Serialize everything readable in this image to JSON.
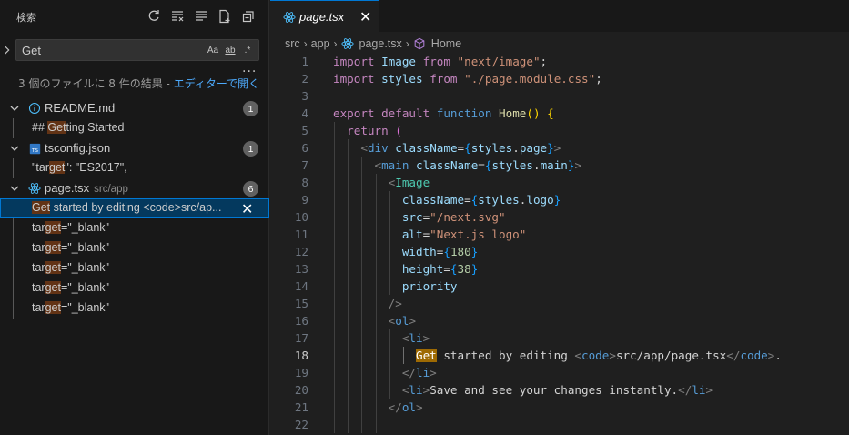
{
  "sidebar": {
    "title": "検索",
    "search": {
      "value": "Get",
      "options": [
        "Aa",
        "ab",
        ".*"
      ]
    },
    "more": "...",
    "summary": {
      "text": "3 個のファイルに 8 件の結果 - ",
      "link": "エディターで開く"
    },
    "results": [
      {
        "kind": "file",
        "name": "README.md",
        "path": "",
        "count": "1",
        "icon": "info-icon",
        "matches": [
          {
            "pre": "## ",
            "hit": "Get",
            "post": "ting Started"
          }
        ]
      },
      {
        "kind": "file",
        "name": "tsconfig.json",
        "path": "",
        "count": "1",
        "icon": "ts-config-icon",
        "matches": [
          {
            "pre": "\"tar",
            "hit": "get",
            "post": "\": \"ES2017\","
          }
        ]
      },
      {
        "kind": "file",
        "name": "page.tsx",
        "path": "src/app",
        "count": "6",
        "icon": "react-icon",
        "matches": [
          {
            "pre": "",
            "hit": "Get",
            "post": " started by editing <code>src/ap...",
            "selected": true
          },
          {
            "pre": "tar",
            "hit": "get",
            "post": "=\"_blank\""
          },
          {
            "pre": "tar",
            "hit": "get",
            "post": "=\"_blank\""
          },
          {
            "pre": "tar",
            "hit": "get",
            "post": "=\"_blank\""
          },
          {
            "pre": "tar",
            "hit": "get",
            "post": "=\"_blank\""
          },
          {
            "pre": "tar",
            "hit": "get",
            "post": "=\"_blank\""
          }
        ]
      }
    ]
  },
  "editor": {
    "tab": {
      "label": "page.tsx"
    },
    "breadcrumb": [
      "src",
      "app",
      "page.tsx",
      "Home"
    ],
    "active_line": 18,
    "lines": [
      [
        [
          "k",
          "import"
        ],
        [
          "w",
          " "
        ],
        [
          "v",
          "Image"
        ],
        [
          "w",
          " "
        ],
        [
          "k",
          "from"
        ],
        [
          "w",
          " "
        ],
        [
          "s",
          "\"next/image\""
        ],
        [
          "w",
          ";"
        ]
      ],
      [
        [
          "k",
          "import"
        ],
        [
          "w",
          " "
        ],
        [
          "v",
          "styles"
        ],
        [
          "w",
          " "
        ],
        [
          "k",
          "from"
        ],
        [
          "w",
          " "
        ],
        [
          "s",
          "\"./page.module.css\""
        ],
        [
          "w",
          ";"
        ]
      ],
      [],
      [
        [
          "k",
          "export"
        ],
        [
          "w",
          " "
        ],
        [
          "k",
          "default"
        ],
        [
          "w",
          " "
        ],
        [
          "kb",
          "function"
        ],
        [
          "w",
          " "
        ],
        [
          "f",
          "Home"
        ],
        [
          "br1",
          "()"
        ],
        [
          "w",
          " "
        ],
        [
          "br1",
          "{"
        ]
      ],
      [
        [
          "w",
          "  "
        ],
        [
          "k",
          "return"
        ],
        [
          "w",
          " "
        ],
        [
          "br2",
          "("
        ]
      ],
      [
        [
          "w",
          "    "
        ],
        [
          "p",
          "<"
        ],
        [
          "kb",
          "div"
        ],
        [
          "w",
          " "
        ],
        [
          "v",
          "className"
        ],
        [
          "w",
          "="
        ],
        [
          "br3",
          "{"
        ],
        [
          "v",
          "styles"
        ],
        [
          "w",
          "."
        ],
        [
          "v",
          "page"
        ],
        [
          "br3",
          "}"
        ],
        [
          "p",
          ">"
        ]
      ],
      [
        [
          "w",
          "      "
        ],
        [
          "p",
          "<"
        ],
        [
          "kb",
          "main"
        ],
        [
          "w",
          " "
        ],
        [
          "v",
          "className"
        ],
        [
          "w",
          "="
        ],
        [
          "br3",
          "{"
        ],
        [
          "v",
          "styles"
        ],
        [
          "w",
          "."
        ],
        [
          "v",
          "main"
        ],
        [
          "br3",
          "}"
        ],
        [
          "p",
          ">"
        ]
      ],
      [
        [
          "w",
          "        "
        ],
        [
          "p",
          "<"
        ],
        [
          "t",
          "Image"
        ]
      ],
      [
        [
          "w",
          "          "
        ],
        [
          "v",
          "className"
        ],
        [
          "w",
          "="
        ],
        [
          "br3",
          "{"
        ],
        [
          "v",
          "styles"
        ],
        [
          "w",
          "."
        ],
        [
          "v",
          "logo"
        ],
        [
          "br3",
          "}"
        ]
      ],
      [
        [
          "w",
          "          "
        ],
        [
          "v",
          "src"
        ],
        [
          "w",
          "="
        ],
        [
          "s",
          "\"/next.svg\""
        ]
      ],
      [
        [
          "w",
          "          "
        ],
        [
          "v",
          "alt"
        ],
        [
          "w",
          "="
        ],
        [
          "s",
          "\"Next.js logo\""
        ]
      ],
      [
        [
          "w",
          "          "
        ],
        [
          "v",
          "width"
        ],
        [
          "w",
          "="
        ],
        [
          "br3",
          "{"
        ],
        [
          "n",
          "180"
        ],
        [
          "br3",
          "}"
        ]
      ],
      [
        [
          "w",
          "          "
        ],
        [
          "v",
          "height"
        ],
        [
          "w",
          "="
        ],
        [
          "br3",
          "{"
        ],
        [
          "n",
          "38"
        ],
        [
          "br3",
          "}"
        ]
      ],
      [
        [
          "w",
          "          "
        ],
        [
          "v",
          "priority"
        ]
      ],
      [
        [
          "w",
          "        "
        ],
        [
          "p",
          "/>"
        ]
      ],
      [
        [
          "w",
          "        "
        ],
        [
          "p",
          "<"
        ],
        [
          "kb",
          "ol"
        ],
        [
          "p",
          ">"
        ]
      ],
      [
        [
          "w",
          "          "
        ],
        [
          "p",
          "<"
        ],
        [
          "kb",
          "li"
        ],
        [
          "p",
          ">"
        ]
      ],
      [
        [
          "w",
          "            "
        ],
        [
          "find",
          "Get"
        ],
        [
          "w",
          " started by editing "
        ],
        [
          "p",
          "<"
        ],
        [
          "kb",
          "code"
        ],
        [
          "p",
          ">"
        ],
        [
          "w",
          "src/app/page.tsx"
        ],
        [
          "p",
          "</"
        ],
        [
          "kb",
          "code"
        ],
        [
          "p",
          ">"
        ],
        [
          "w",
          "."
        ]
      ],
      [
        [
          "w",
          "          "
        ],
        [
          "p",
          "</"
        ],
        [
          "kb",
          "li"
        ],
        [
          "p",
          ">"
        ]
      ],
      [
        [
          "w",
          "          "
        ],
        [
          "p",
          "<"
        ],
        [
          "kb",
          "li"
        ],
        [
          "p",
          ">"
        ],
        [
          "w",
          "Save and see your changes instantly."
        ],
        [
          "p",
          "</"
        ],
        [
          "kb",
          "li"
        ],
        [
          "p",
          ">"
        ]
      ],
      [
        [
          "w",
          "        "
        ],
        [
          "p",
          "</"
        ],
        [
          "kb",
          "ol"
        ],
        [
          "p",
          ">"
        ]
      ],
      []
    ]
  }
}
